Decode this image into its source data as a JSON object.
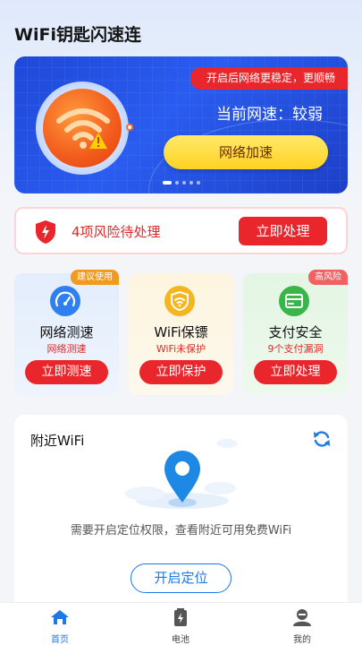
{
  "app": {
    "title": "WiFi钥匙闪速连"
  },
  "banner": {
    "ribbon": "开启后网络更稳定，更顺畅",
    "network_speed": "当前网速：较弱",
    "boost_button": "网络加速",
    "page_count": 5,
    "active_page": 1
  },
  "risk": {
    "text": "4项风险待处理",
    "button": "立即处理"
  },
  "cards": [
    {
      "tag": "建议使用",
      "name": "网络测速",
      "sub": "网络测速",
      "button": "立即测速",
      "icon": "speedometer-icon"
    },
    {
      "tag": "",
      "name": "WiFi保镖",
      "sub": "WiFi未保护",
      "button": "立即保护",
      "icon": "wifi-shield-icon"
    },
    {
      "tag": "高风险",
      "name": "支付安全",
      "sub": "9个支付漏洞",
      "button": "立即处理",
      "icon": "payment-card-icon"
    }
  ],
  "nearby": {
    "title": "附近WiFi",
    "message": "需要开启定位权限，查看附近可用免费WiFi",
    "button": "开启定位"
  },
  "tabs": [
    {
      "label": "首页",
      "icon": "home-icon",
      "active": true
    },
    {
      "label": "电池",
      "icon": "battery-icon",
      "active": false
    },
    {
      "label": "我的",
      "icon": "profile-icon",
      "active": false
    }
  ],
  "colors": {
    "primary_red": "#e8262b",
    "banner_blue": "#2a5cf0",
    "link_blue": "#1d78e8",
    "boost_yellow": "#ffd223"
  }
}
